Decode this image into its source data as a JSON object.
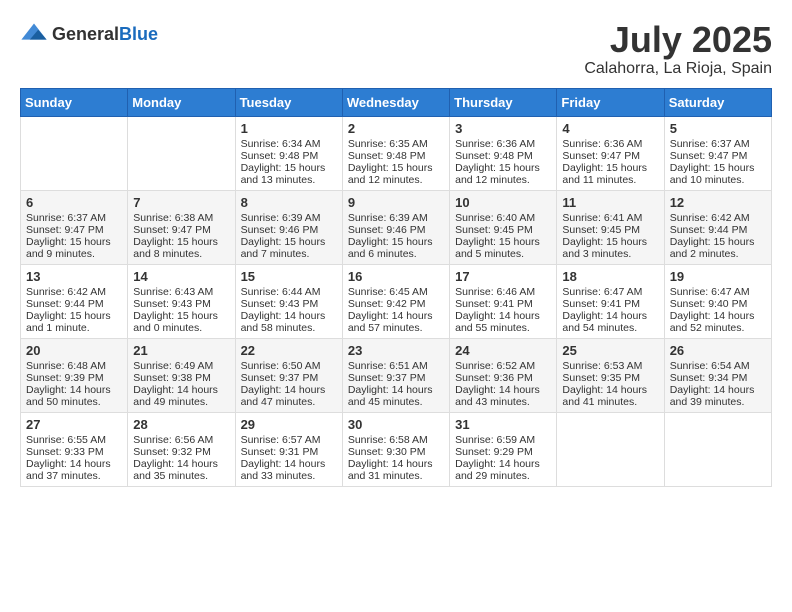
{
  "header": {
    "logo_general": "General",
    "logo_blue": "Blue",
    "month": "July 2025",
    "location": "Calahorra, La Rioja, Spain"
  },
  "weekdays": [
    "Sunday",
    "Monday",
    "Tuesday",
    "Wednesday",
    "Thursday",
    "Friday",
    "Saturday"
  ],
  "weeks": [
    [
      {
        "day": "",
        "sunrise": "",
        "sunset": "",
        "daylight": ""
      },
      {
        "day": "",
        "sunrise": "",
        "sunset": "",
        "daylight": ""
      },
      {
        "day": "1",
        "sunrise": "Sunrise: 6:34 AM",
        "sunset": "Sunset: 9:48 PM",
        "daylight": "Daylight: 15 hours and 13 minutes."
      },
      {
        "day": "2",
        "sunrise": "Sunrise: 6:35 AM",
        "sunset": "Sunset: 9:48 PM",
        "daylight": "Daylight: 15 hours and 12 minutes."
      },
      {
        "day": "3",
        "sunrise": "Sunrise: 6:36 AM",
        "sunset": "Sunset: 9:48 PM",
        "daylight": "Daylight: 15 hours and 12 minutes."
      },
      {
        "day": "4",
        "sunrise": "Sunrise: 6:36 AM",
        "sunset": "Sunset: 9:47 PM",
        "daylight": "Daylight: 15 hours and 11 minutes."
      },
      {
        "day": "5",
        "sunrise": "Sunrise: 6:37 AM",
        "sunset": "Sunset: 9:47 PM",
        "daylight": "Daylight: 15 hours and 10 minutes."
      }
    ],
    [
      {
        "day": "6",
        "sunrise": "Sunrise: 6:37 AM",
        "sunset": "Sunset: 9:47 PM",
        "daylight": "Daylight: 15 hours and 9 minutes."
      },
      {
        "day": "7",
        "sunrise": "Sunrise: 6:38 AM",
        "sunset": "Sunset: 9:47 PM",
        "daylight": "Daylight: 15 hours and 8 minutes."
      },
      {
        "day": "8",
        "sunrise": "Sunrise: 6:39 AM",
        "sunset": "Sunset: 9:46 PM",
        "daylight": "Daylight: 15 hours and 7 minutes."
      },
      {
        "day": "9",
        "sunrise": "Sunrise: 6:39 AM",
        "sunset": "Sunset: 9:46 PM",
        "daylight": "Daylight: 15 hours and 6 minutes."
      },
      {
        "day": "10",
        "sunrise": "Sunrise: 6:40 AM",
        "sunset": "Sunset: 9:45 PM",
        "daylight": "Daylight: 15 hours and 5 minutes."
      },
      {
        "day": "11",
        "sunrise": "Sunrise: 6:41 AM",
        "sunset": "Sunset: 9:45 PM",
        "daylight": "Daylight: 15 hours and 3 minutes."
      },
      {
        "day": "12",
        "sunrise": "Sunrise: 6:42 AM",
        "sunset": "Sunset: 9:44 PM",
        "daylight": "Daylight: 15 hours and 2 minutes."
      }
    ],
    [
      {
        "day": "13",
        "sunrise": "Sunrise: 6:42 AM",
        "sunset": "Sunset: 9:44 PM",
        "daylight": "Daylight: 15 hours and 1 minute."
      },
      {
        "day": "14",
        "sunrise": "Sunrise: 6:43 AM",
        "sunset": "Sunset: 9:43 PM",
        "daylight": "Daylight: 15 hours and 0 minutes."
      },
      {
        "day": "15",
        "sunrise": "Sunrise: 6:44 AM",
        "sunset": "Sunset: 9:43 PM",
        "daylight": "Daylight: 14 hours and 58 minutes."
      },
      {
        "day": "16",
        "sunrise": "Sunrise: 6:45 AM",
        "sunset": "Sunset: 9:42 PM",
        "daylight": "Daylight: 14 hours and 57 minutes."
      },
      {
        "day": "17",
        "sunrise": "Sunrise: 6:46 AM",
        "sunset": "Sunset: 9:41 PM",
        "daylight": "Daylight: 14 hours and 55 minutes."
      },
      {
        "day": "18",
        "sunrise": "Sunrise: 6:47 AM",
        "sunset": "Sunset: 9:41 PM",
        "daylight": "Daylight: 14 hours and 54 minutes."
      },
      {
        "day": "19",
        "sunrise": "Sunrise: 6:47 AM",
        "sunset": "Sunset: 9:40 PM",
        "daylight": "Daylight: 14 hours and 52 minutes."
      }
    ],
    [
      {
        "day": "20",
        "sunrise": "Sunrise: 6:48 AM",
        "sunset": "Sunset: 9:39 PM",
        "daylight": "Daylight: 14 hours and 50 minutes."
      },
      {
        "day": "21",
        "sunrise": "Sunrise: 6:49 AM",
        "sunset": "Sunset: 9:38 PM",
        "daylight": "Daylight: 14 hours and 49 minutes."
      },
      {
        "day": "22",
        "sunrise": "Sunrise: 6:50 AM",
        "sunset": "Sunset: 9:37 PM",
        "daylight": "Daylight: 14 hours and 47 minutes."
      },
      {
        "day": "23",
        "sunrise": "Sunrise: 6:51 AM",
        "sunset": "Sunset: 9:37 PM",
        "daylight": "Daylight: 14 hours and 45 minutes."
      },
      {
        "day": "24",
        "sunrise": "Sunrise: 6:52 AM",
        "sunset": "Sunset: 9:36 PM",
        "daylight": "Daylight: 14 hours and 43 minutes."
      },
      {
        "day": "25",
        "sunrise": "Sunrise: 6:53 AM",
        "sunset": "Sunset: 9:35 PM",
        "daylight": "Daylight: 14 hours and 41 minutes."
      },
      {
        "day": "26",
        "sunrise": "Sunrise: 6:54 AM",
        "sunset": "Sunset: 9:34 PM",
        "daylight": "Daylight: 14 hours and 39 minutes."
      }
    ],
    [
      {
        "day": "27",
        "sunrise": "Sunrise: 6:55 AM",
        "sunset": "Sunset: 9:33 PM",
        "daylight": "Daylight: 14 hours and 37 minutes."
      },
      {
        "day": "28",
        "sunrise": "Sunrise: 6:56 AM",
        "sunset": "Sunset: 9:32 PM",
        "daylight": "Daylight: 14 hours and 35 minutes."
      },
      {
        "day": "29",
        "sunrise": "Sunrise: 6:57 AM",
        "sunset": "Sunset: 9:31 PM",
        "daylight": "Daylight: 14 hours and 33 minutes."
      },
      {
        "day": "30",
        "sunrise": "Sunrise: 6:58 AM",
        "sunset": "Sunset: 9:30 PM",
        "daylight": "Daylight: 14 hours and 31 minutes."
      },
      {
        "day": "31",
        "sunrise": "Sunrise: 6:59 AM",
        "sunset": "Sunset: 9:29 PM",
        "daylight": "Daylight: 14 hours and 29 minutes."
      },
      {
        "day": "",
        "sunrise": "",
        "sunset": "",
        "daylight": ""
      },
      {
        "day": "",
        "sunrise": "",
        "sunset": "",
        "daylight": ""
      }
    ]
  ]
}
